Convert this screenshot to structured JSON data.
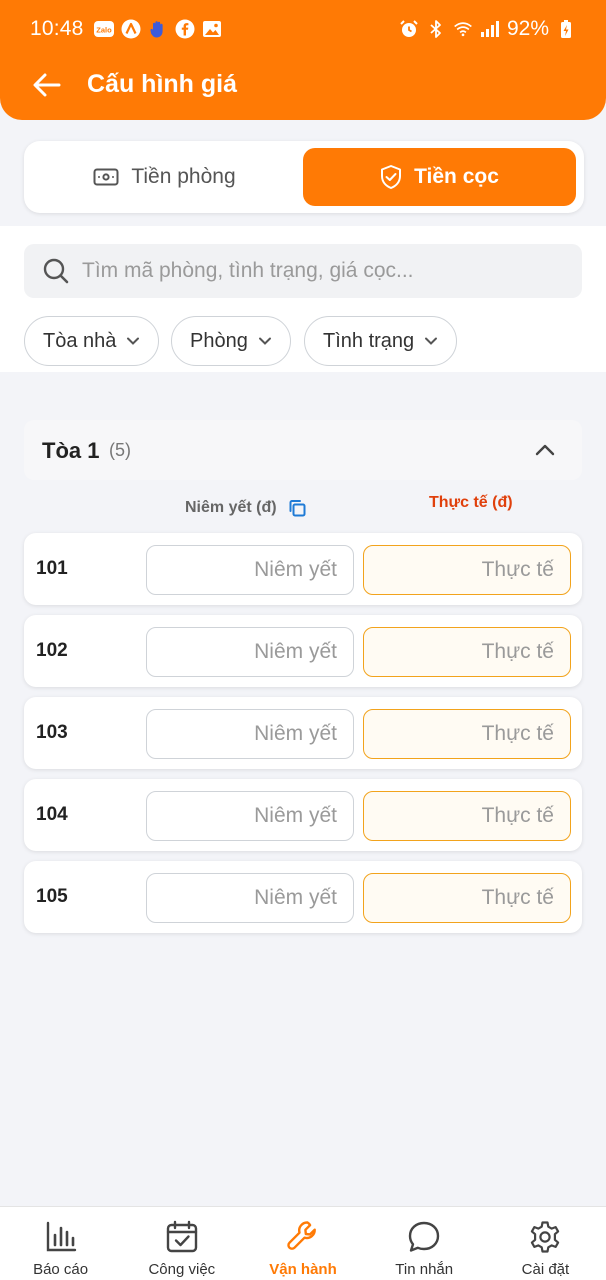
{
  "status_bar": {
    "time": "10:48",
    "battery_percent": "92%",
    "notification_icons": [
      "zalo-icon",
      "a-app-icon",
      "hand-icon",
      "facebook-icon",
      "gallery-icon"
    ],
    "system_icons": [
      "alarm-icon",
      "bluetooth-icon",
      "wifi-icon",
      "signal-icon",
      "battery-charging-icon"
    ]
  },
  "header": {
    "title": "Cấu hình giá",
    "background_color": "#ff7a05"
  },
  "segment": {
    "tabs": [
      {
        "label": "Tiền phòng",
        "icon": "cash-icon",
        "selected": false
      },
      {
        "label": "Tiền cọc",
        "icon": "shield-check-icon",
        "selected": true
      }
    ]
  },
  "search": {
    "placeholder": "Tìm mã phòng, tình trạng, giá cọc..."
  },
  "filters": [
    {
      "label": "Tòa nhà"
    },
    {
      "label": "Phòng"
    },
    {
      "label": "Tình trạng"
    }
  ],
  "group": {
    "title": "Tòa 1",
    "count": "(5)",
    "expanded": true
  },
  "columns": {
    "listed": "Niêm yết (đ)",
    "actual": "Thực tế (đ)"
  },
  "rows": [
    {
      "room": "101",
      "listed_placeholder": "Niêm yết",
      "actual_placeholder": "Thực tế"
    },
    {
      "room": "102",
      "listed_placeholder": "Niêm yết",
      "actual_placeholder": "Thực tế"
    },
    {
      "room": "103",
      "listed_placeholder": "Niêm yết",
      "actual_placeholder": "Thực tế"
    },
    {
      "room": "104",
      "listed_placeholder": "Niêm yết",
      "actual_placeholder": "Thực tế"
    },
    {
      "room": "105",
      "listed_placeholder": "Niêm yết",
      "actual_placeholder": "Thực tế"
    }
  ],
  "bottom_nav": [
    {
      "label": "Báo cáo",
      "icon": "bar-chart-icon",
      "active": false
    },
    {
      "label": "Công việc",
      "icon": "calendar-check-icon",
      "active": false
    },
    {
      "label": "Vận hành",
      "icon": "wrench-icon",
      "active": true
    },
    {
      "label": "Tin nhắn",
      "icon": "chat-bubble-icon",
      "active": false
    },
    {
      "label": "Cài đặt",
      "icon": "gear-icon",
      "active": false
    }
  ],
  "colors": {
    "accent": "#ff7a05",
    "actual_header": "#e0400c",
    "actual_border": "#f2a31c"
  }
}
